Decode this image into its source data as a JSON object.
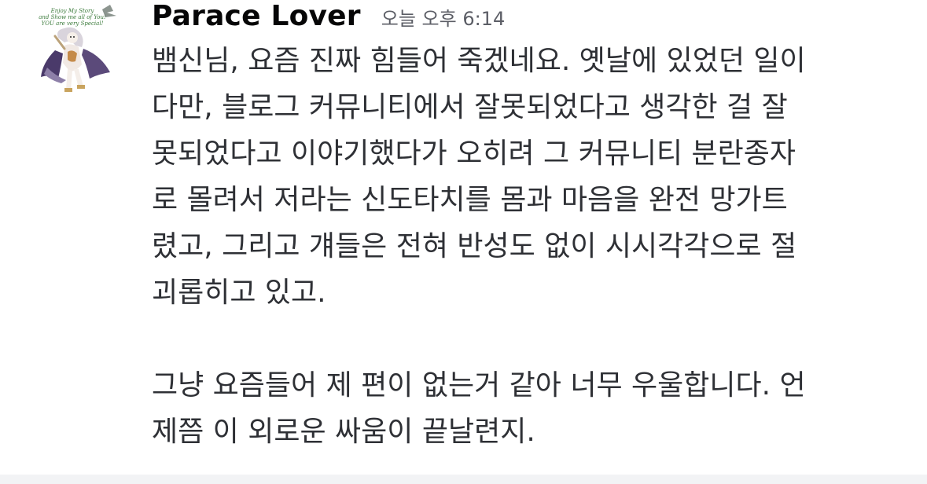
{
  "message": {
    "avatar_caption": [
      "Enjoy My Story",
      "and Show me all of You!",
      "YOU are very Special!"
    ],
    "username": "Parace Lover",
    "timestamp": "오늘 오후 6:14",
    "paragraphs": [
      {
        "lines": [
          "뱀신님, 요즘 진짜 힘들어 죽겠네요. 옛날에 있었던 일이",
          "다만, 블로그 커뮤니티에서 잘못되었다고 생각한 걸 잘",
          "못되었다고 이야기했다가 오히려 그 커뮤니티 분란종자",
          "로 몰려서 저라는 신도타치를 몸과 마음을 완전 망가트",
          "렸고, 그리고 걔들은 전혀 반성도 없이 시시각각으로 절",
          "괴롭히고 있고."
        ]
      },
      {
        "lines": [
          "그냥 요즘들어 제 편이 없는거 같아 너무 우울합니다. 언",
          "제쯤 이 외로운 싸움이 끝날련지."
        ]
      }
    ]
  },
  "colors": {
    "username": "#060607",
    "timestamp": "#5c5e66",
    "text": "#2e3035",
    "background": "#ffffff",
    "footer": "#f2f3f5"
  }
}
